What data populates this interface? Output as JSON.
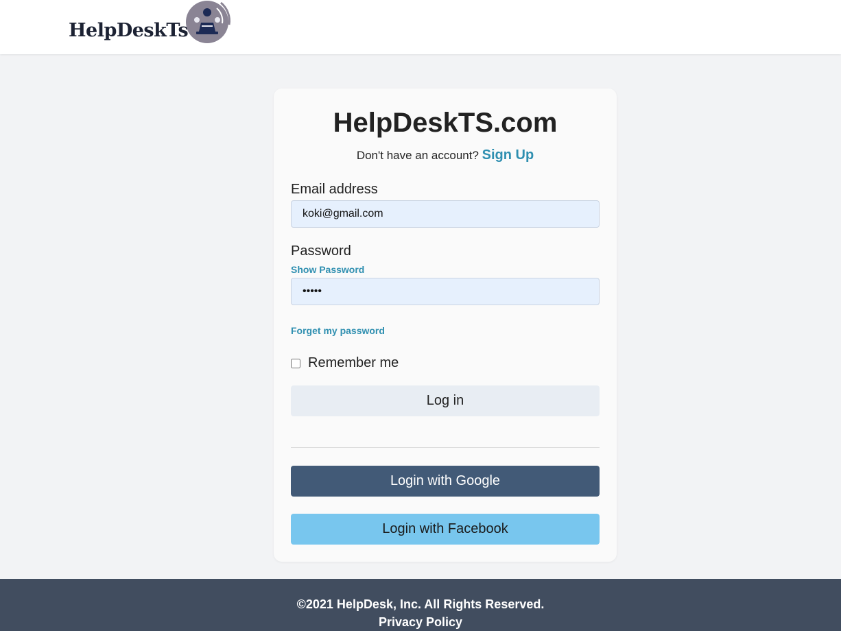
{
  "header": {
    "logo_text": "HelpDeskTs"
  },
  "card": {
    "title_bold": "HelpDeskTS",
    "title_suffix": ".com",
    "signup_prompt": "Don't have an account?",
    "signup_link": "Sign Up",
    "email_label": "Email address",
    "email_value": "koki@gmail.com",
    "password_label": "Password",
    "show_password": "Show Password",
    "password_value": "•••••",
    "forgot_password": "Forget my password",
    "remember_me": "Remember me",
    "login_button": "Log in",
    "google_button": "Login with Google",
    "facebook_button": "Login with Facebook"
  },
  "footer": {
    "copyright": "©2021 HelpDesk, Inc. All Rights Reserved.",
    "privacy": "Privacy Policy"
  },
  "colors": {
    "accent_link": "#2f8fb0",
    "google_button": "#425a77",
    "facebook_button": "#78c6ee",
    "footer_bg": "#414d5f",
    "input_bg": "#e6f0fd"
  }
}
